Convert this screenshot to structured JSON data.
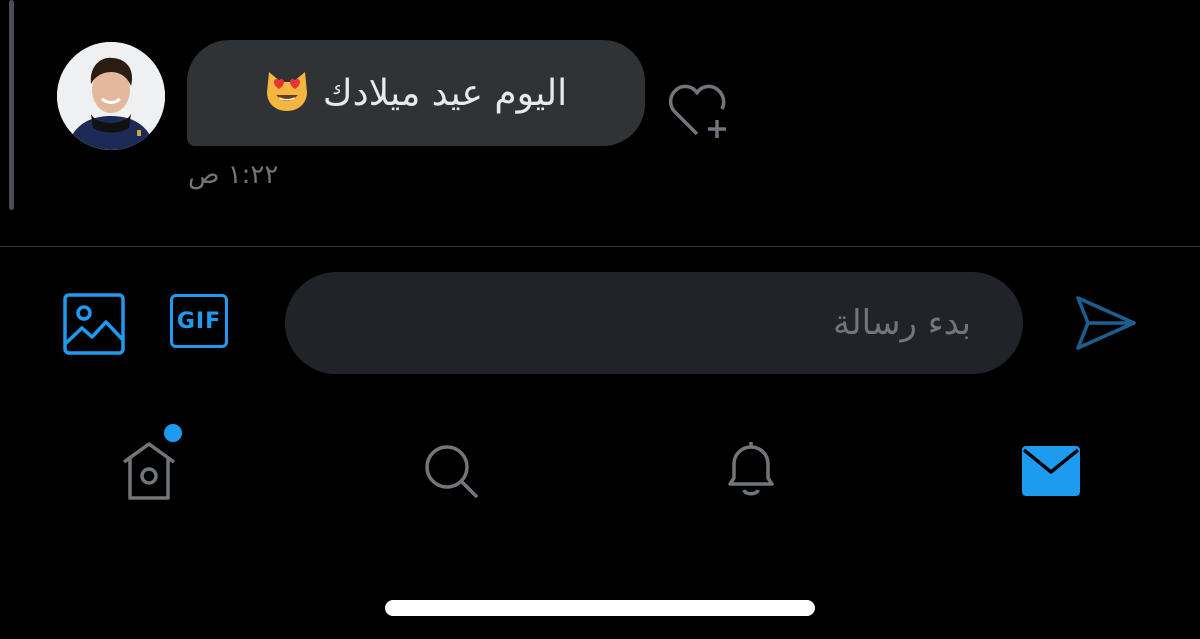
{
  "conversation": {
    "message": {
      "text": "اليوم عيد ميلادك",
      "emoji": "smiling-cat-heart-eyes",
      "timestamp": "١:٢٢ ص"
    },
    "react_icon": "heart-plus-icon"
  },
  "composer": {
    "placeholder": "بدء رسالة",
    "image_icon": "image-icon",
    "gif_label": "GIF",
    "send_icon": "send-icon"
  },
  "bottom_nav": {
    "items": [
      {
        "icon": "home-icon",
        "has_badge": true
      },
      {
        "icon": "search-icon"
      },
      {
        "icon": "bell-icon"
      },
      {
        "icon": "mail-icon",
        "active": true
      }
    ]
  },
  "colors": {
    "background": "#000000",
    "bubble": "#2f3336",
    "accent": "#1d9bf0",
    "muted": "#71767b",
    "input_bg": "#202327"
  }
}
